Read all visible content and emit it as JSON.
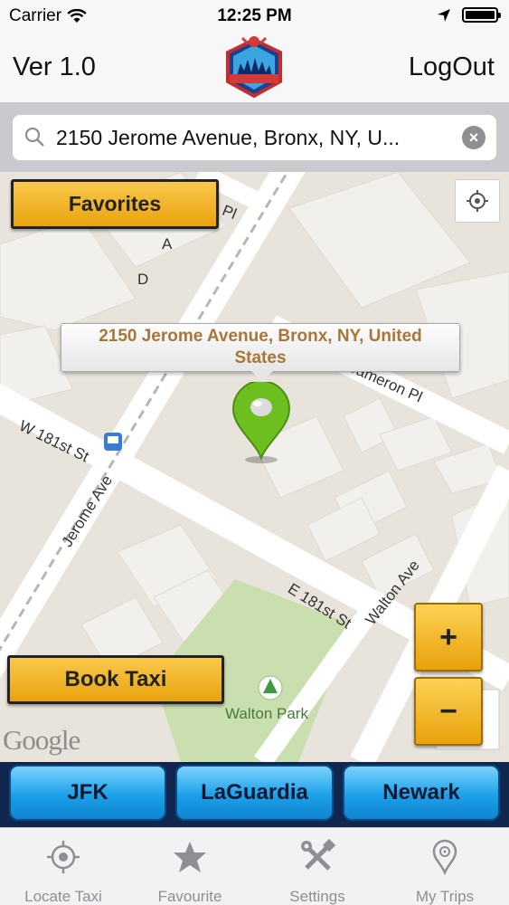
{
  "status_bar": {
    "carrier": "Carrier",
    "time": "12:25 PM"
  },
  "nav": {
    "version": "Ver 1.0",
    "logout": "LogOut"
  },
  "search": {
    "value": "2150 Jerome Avenue, Bronx, NY, U..."
  },
  "map": {
    "favorites_label": "Favorites",
    "book_taxi_label": "Book Taxi",
    "callout_line1": "2150 Jerome Avenue, Bronx, NY, United",
    "callout_line2": "States",
    "zoom_in": "+",
    "zoom_out": "−",
    "attribution": "Google",
    "labels": {
      "a": "A",
      "d": "D",
      "pl": "Pl",
      "cameron": "Cameron Pl",
      "w181": "W 181st St",
      "jerome": "Jerome Ave",
      "e181": "E 181st St",
      "walton_ave": "Walton Ave",
      "walton_park": "Walton Park"
    }
  },
  "airports": [
    "JFK",
    "LaGuardia",
    "Newark"
  ],
  "tabs": [
    {
      "label": "Locate Taxi",
      "icon": "crosshair-icon"
    },
    {
      "label": "Favourite",
      "icon": "star-icon"
    },
    {
      "label": "Settings",
      "icon": "tools-icon"
    },
    {
      "label": "My Trips",
      "icon": "pin-icon"
    }
  ],
  "colors": {
    "accent_yellow": "#f0b12a",
    "airport_blue": "#1ca0ea",
    "callout_text": "#a67737",
    "pin_green": "#6cbf1e"
  }
}
